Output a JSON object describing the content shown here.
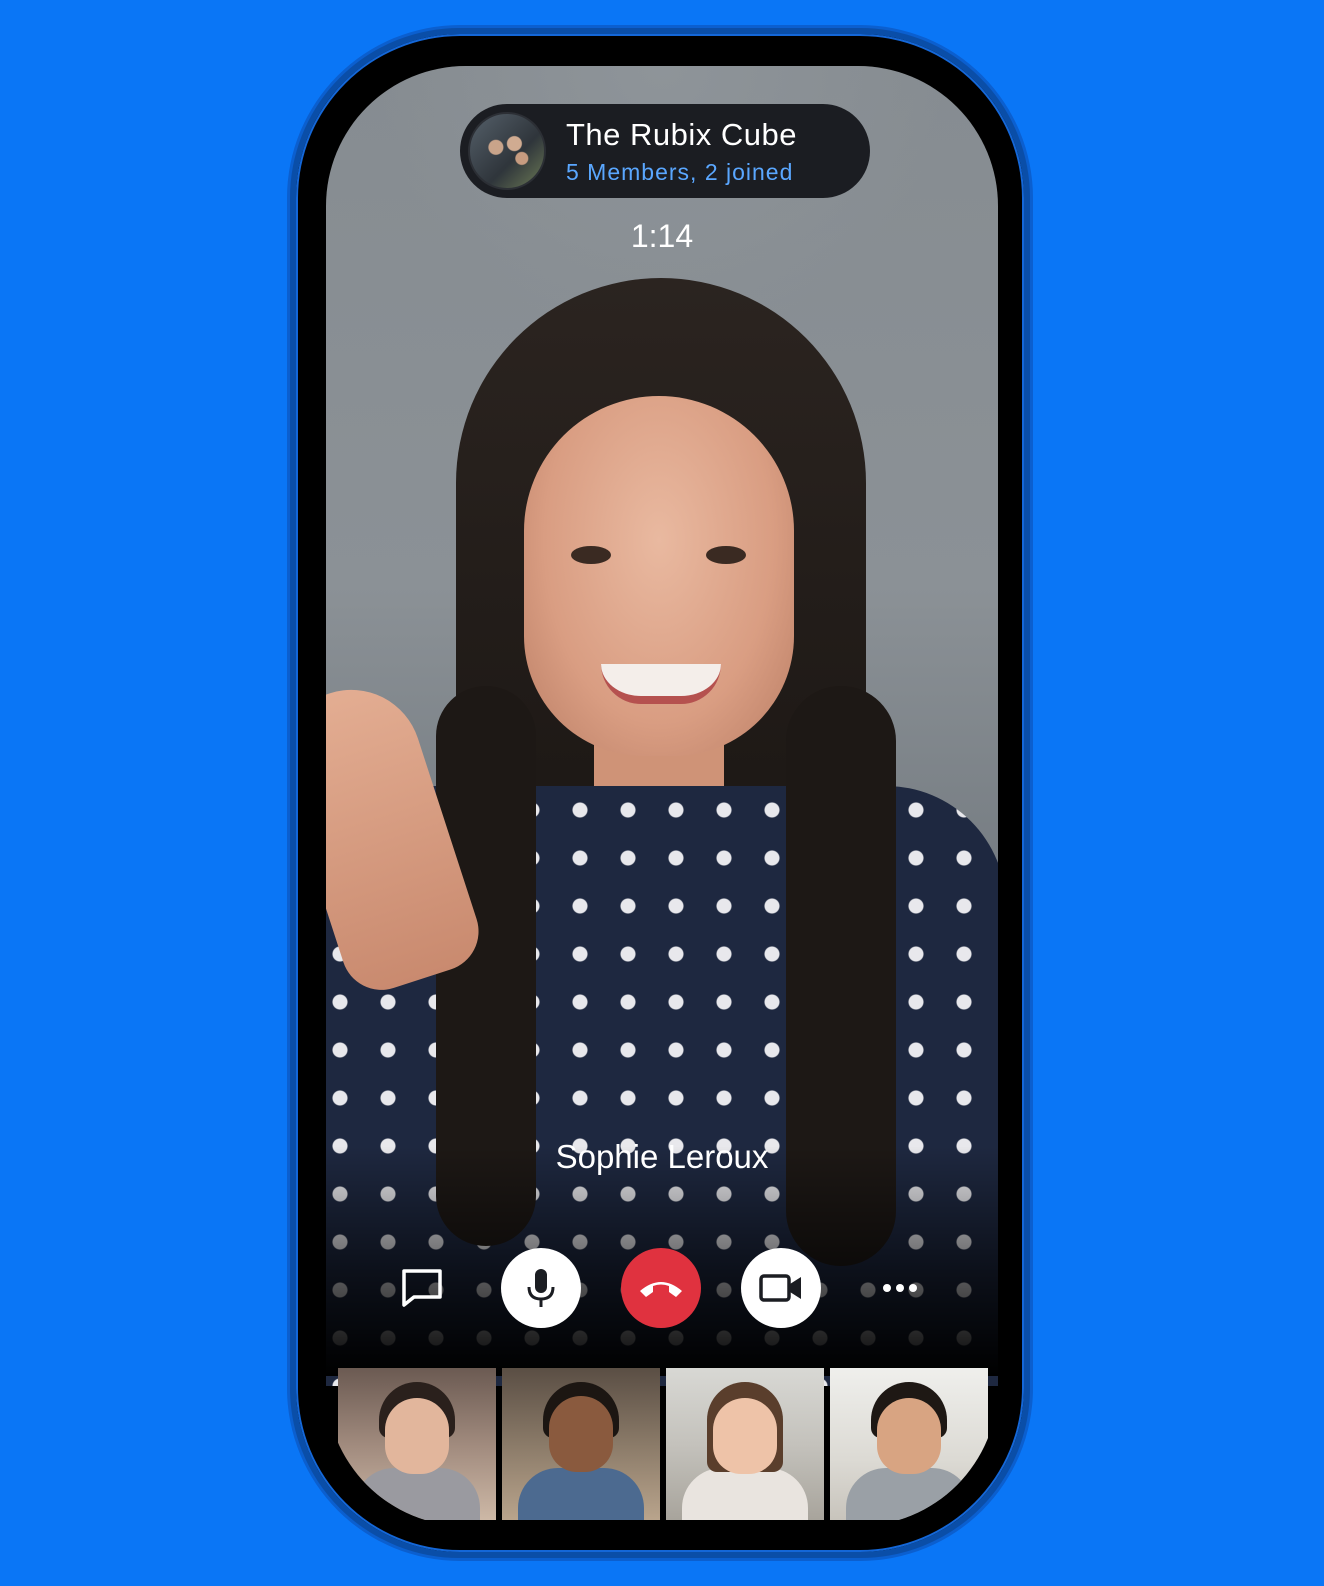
{
  "call": {
    "group_name": "The Rubix Cube",
    "members_status": "5 Members, 2 joined",
    "timer": "1:14",
    "active_speaker": "Sophie Leroux"
  },
  "controls": [
    {
      "name": "chat-button",
      "icon": "chat-bubble-icon"
    },
    {
      "name": "mute-button",
      "icon": "microphone-icon"
    },
    {
      "name": "end-call-button",
      "icon": "hang-up-phone-icon"
    },
    {
      "name": "camera-button",
      "icon": "video-camera-icon"
    },
    {
      "name": "more-options-button",
      "icon": "more-horizontal-icon"
    }
  ],
  "participants": [
    {
      "thumb": "participant-thumbnail-1"
    },
    {
      "thumb": "participant-thumbnail-2"
    },
    {
      "thumb": "participant-thumbnail-3"
    },
    {
      "thumb": "participant-thumbnail-4"
    }
  ],
  "colors": {
    "background": "#0a76f6",
    "accent_text": "#5aa7ff",
    "end_call": "#e0323f",
    "pill": "#1b1d22"
  }
}
